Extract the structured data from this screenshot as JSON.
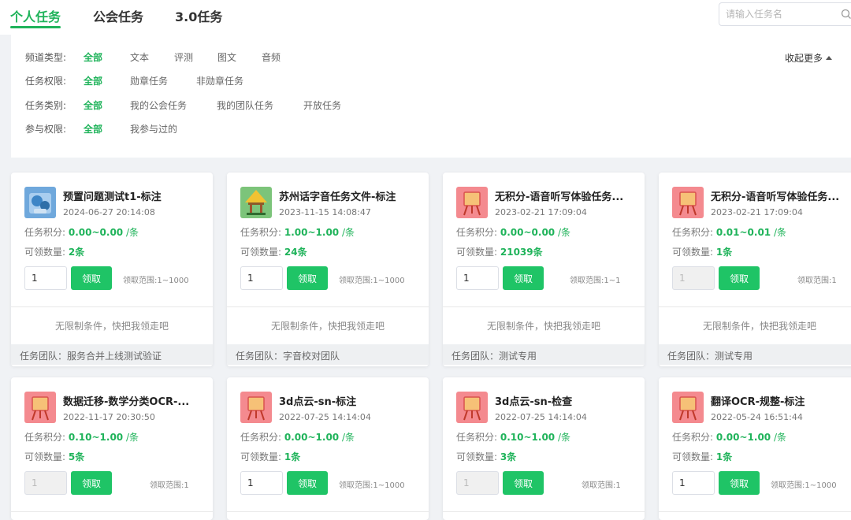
{
  "tabs": [
    {
      "label": "个人任务",
      "active": true
    },
    {
      "label": "公会任务",
      "active": false
    },
    {
      "label": "3.0任务",
      "active": false
    }
  ],
  "search": {
    "placeholder": "请输入任务名",
    "icon": "search-icon"
  },
  "filters": [
    {
      "label": "频道类型:",
      "options": [
        "全部",
        "文本",
        "评测",
        "图文",
        "音频"
      ],
      "selected": "全部"
    },
    {
      "label": "任务权限:",
      "options": [
        "全部",
        "勋章任务",
        "非勋章任务"
      ],
      "selected": "全部"
    },
    {
      "label": "任务类别:",
      "options": [
        "全部",
        "我的公会任务",
        "我的团队任务",
        "开放任务"
      ],
      "selected": "全部"
    },
    {
      "label": "参与权限:",
      "options": [
        "全部",
        "我参与过的"
      ],
      "selected": "全部"
    }
  ],
  "collapse_label": "收起更多",
  "card_labels": {
    "points": "任务积分:",
    "count": "可领数量:",
    "unit": "/条",
    "claim": "领取",
    "no_limit": "无限制条件，快把我领走吧",
    "team": "任务团队："
  },
  "colors": {
    "accent": "#1fb35a",
    "button": "#1fc466"
  },
  "cards": [
    {
      "title": "预置问题测试t1-标注",
      "date": "2024-06-27 20:14:08",
      "points": "0.00~0.00",
      "count": "2条",
      "qty": "1",
      "qty_disabled": false,
      "range": "领取范围:1~1000",
      "team": "服务合并上线测试验证",
      "icon": "blue-figure-icon"
    },
    {
      "title": "苏州话字音任务文件-标注",
      "date": "2023-11-15 14:08:47",
      "points": "1.00~1.00",
      "count": "24条",
      "qty": "1",
      "qty_disabled": false,
      "range": "领取范围:1~1000",
      "team": "字音校对团队",
      "icon": "pavilion-icon"
    },
    {
      "title": "无积分-语音听写体验任务...",
      "date": "2023-02-21 17:09:04",
      "points": "0.00~0.00",
      "count": "21039条",
      "qty": "1",
      "qty_disabled": false,
      "range": "领取范围:1~1",
      "team": "测试专用",
      "icon": "easel-icon"
    },
    {
      "title": "无积分-语音听写体验任务...",
      "date": "2023-02-21 17:09:04",
      "points": "0.01~0.01",
      "count": "1条",
      "qty": "1",
      "qty_disabled": true,
      "range": "领取范围:1",
      "team": "测试专用",
      "icon": "easel-icon"
    },
    {
      "title": "数据迁移-数学分类OCR-...",
      "date": "2022-11-17 20:30:50",
      "points": "0.10~1.00",
      "count": "5条",
      "qty": "1",
      "qty_disabled": true,
      "range": "领取范围:1",
      "team": "",
      "icon": "easel-icon"
    },
    {
      "title": "3d点云-sn-标注",
      "date": "2022-07-25 14:14:04",
      "points": "0.00~1.00",
      "count": "1条",
      "qty": "1",
      "qty_disabled": false,
      "range": "领取范围:1~1000",
      "team": "",
      "icon": "easel-icon"
    },
    {
      "title": "3d点云-sn-检查",
      "date": "2022-07-25 14:14:04",
      "points": "0.10~1.00",
      "count": "3条",
      "qty": "1",
      "qty_disabled": true,
      "range": "领取范围:1",
      "team": "",
      "icon": "easel-icon"
    },
    {
      "title": "翻译OCR-规整-标注",
      "date": "2022-05-24 16:51:44",
      "points": "0.00~1.00",
      "count": "1条",
      "qty": "1",
      "qty_disabled": false,
      "range": "领取范围:1~1000",
      "team": "",
      "icon": "easel-icon"
    }
  ]
}
